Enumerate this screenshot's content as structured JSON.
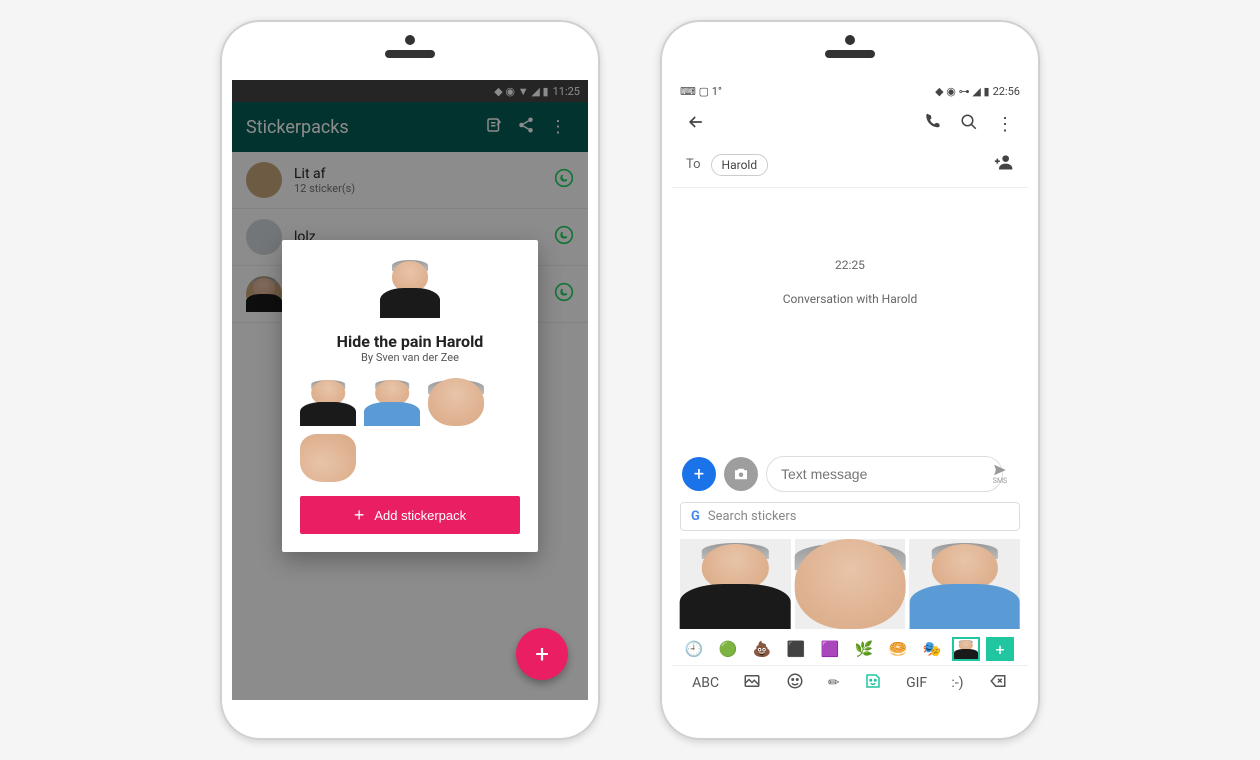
{
  "phone1": {
    "status_time": "11:25",
    "appbar_title": "Stickerpacks",
    "packs": [
      {
        "name": "Lit af",
        "sub": "12 sticker(s)"
      },
      {
        "name": "lolz",
        "sub": ""
      },
      {
        "name": "",
        "sub": ""
      }
    ],
    "modal": {
      "title": "Hide the pain Harold",
      "author": "By Sven van der Zee",
      "add_label": "Add stickerpack"
    }
  },
  "phone2": {
    "status_left": "1°",
    "status_time": "22:56",
    "to_label": "To",
    "recipient": "Harold",
    "conv_time": "22:25",
    "conv_label": "Conversation with Harold",
    "input_placeholder": "Text message",
    "send_label": "SMS",
    "search_placeholder": "Search stickers",
    "kb_abc": "ABC",
    "kb_gif": "GIF",
    "kb_emo": ":-)"
  }
}
